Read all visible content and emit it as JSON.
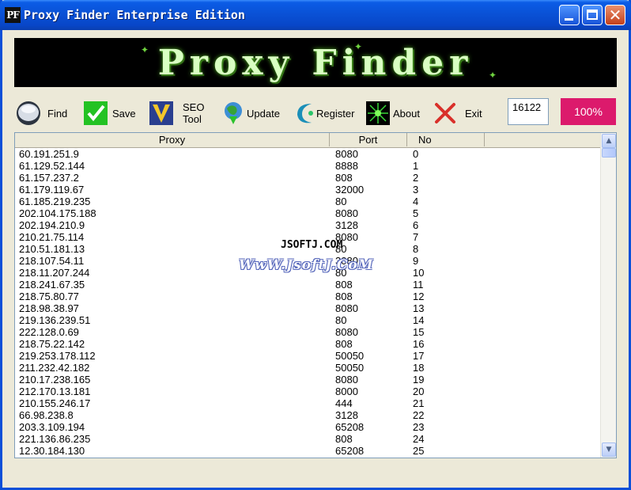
{
  "window": {
    "app_icon_text": "PF",
    "title": "Proxy Finder Enterprise Edition"
  },
  "banner": {
    "logo_text": "Proxy Finder"
  },
  "toolbar": {
    "find": "Find",
    "save": "Save",
    "seo_line1": "SEO",
    "seo_line2": "Tool",
    "update": "Update",
    "register": "Register",
    "about": "About",
    "exit": "Exit"
  },
  "status": {
    "count": "16122",
    "progress": "100%",
    "progress_fraction": 1.0
  },
  "list": {
    "columns": [
      "Proxy",
      "Port",
      "No"
    ],
    "rows": [
      [
        "60.191.251.9",
        "8080",
        "0"
      ],
      [
        "61.129.52.144",
        "8888",
        "1"
      ],
      [
        "61.157.237.2",
        "808",
        "2"
      ],
      [
        "61.179.119.67",
        "32000",
        "3"
      ],
      [
        "61.185.219.235",
        "80",
        "4"
      ],
      [
        "202.104.175.188",
        "8080",
        "5"
      ],
      [
        "202.194.210.9",
        "3128",
        "6"
      ],
      [
        "210.21.75.114",
        "8080",
        "7"
      ],
      [
        "210.51.181.13",
        "80",
        "8"
      ],
      [
        "218.107.54.11",
        "3080",
        "9"
      ],
      [
        "218.11.207.244",
        "80",
        "10"
      ],
      [
        "218.241.67.35",
        "808",
        "11"
      ],
      [
        "218.75.80.77",
        "808",
        "12"
      ],
      [
        "218.98.38.97",
        "8080",
        "13"
      ],
      [
        "219.136.239.51",
        "80",
        "14"
      ],
      [
        "222.128.0.69",
        "8080",
        "15"
      ],
      [
        "218.75.22.142",
        "808",
        "16"
      ],
      [
        "219.253.178.112",
        "50050",
        "17"
      ],
      [
        "211.232.42.182",
        "50050",
        "18"
      ],
      [
        "210.17.238.165",
        "8080",
        "19"
      ],
      [
        "212.170.13.181",
        "8000",
        "20"
      ],
      [
        "210.155.246.17",
        "444",
        "21"
      ],
      [
        "66.98.238.8",
        "3128",
        "22"
      ],
      [
        "203.3.109.194",
        "65208",
        "23"
      ],
      [
        "221.136.86.235",
        "808",
        "24"
      ],
      [
        "12.30.184.130",
        "65208",
        "25"
      ]
    ]
  },
  "watermark": {
    "line1": "JSOFTJ.COM",
    "line2": "WwW.JsoftJ.CoM"
  },
  "icons": [
    "app-icon",
    "find-icon",
    "save-icon",
    "seo-tool-icon",
    "update-icon",
    "register-icon",
    "about-icon",
    "exit-icon",
    "minimize-icon",
    "maximize-icon",
    "close-icon"
  ]
}
